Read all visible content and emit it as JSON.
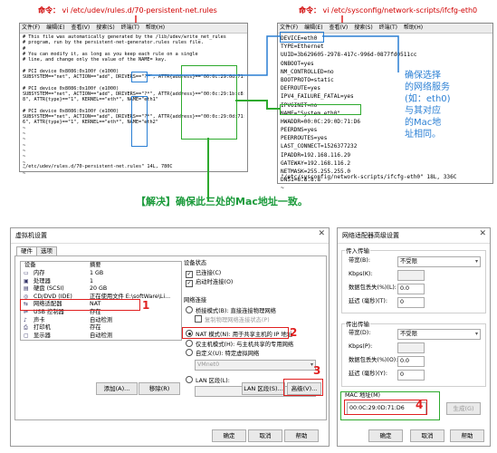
{
  "annotations": {
    "left_cmd_prefix": "命令：",
    "left_cmd_path": "vi /etc/udev/rules.d/70-persistent-net.rules",
    "right_cmd_prefix": "命令：",
    "right_cmd_path": "vi /etc/sysconfig/network-scripts/ifcfg-eth0",
    "blue_note": [
      "确保选择",
      "的网络服务",
      "(如：eth0)",
      "与其对应",
      "的Mac地",
      "址相同。"
    ],
    "solution": "【解决】确保此三处的Mac地址一致。",
    "markers": [
      "1",
      "2",
      "3",
      "4"
    ],
    "colors": {
      "red": "#e02020",
      "green": "#2eaa2e",
      "blue": "#2a7fd4"
    }
  },
  "term_menu": [
    "文件(F)",
    "编辑(E)",
    "查看(V)",
    "搜索(S)",
    "终端(T)",
    "帮助(H)"
  ],
  "left_terminal": {
    "lines": [
      "# This file was automatically generated by the /lib/udev/write_net_rules",
      "# program, run by the persistent-net-generator.rules rules file.",
      "#",
      "# You can modify it, as long as you keep each rule on a single",
      "# line, and change only the value of the NAME= key.",
      "",
      "# PCI device 0x8086:0x100f (e1000)",
      "SUBSYSTEM==\"net\", ACTION==\"add\", DRIVERS==\"?*\", ATTR{address}==\"00:0c:29:0d:71:d6\", ATTR{type}==\"1\", KERNEL==\"eth*\", NAME=\"eth0\"",
      "",
      "# PCI device 0x8086:0x100f (e1000)",
      "SUBSYSTEM==\"net\", ACTION==\"add\", DRIVERS==\"?*\", ATTR{address}==\"00:0c:29:1b:c8:0\"",
      "8\", ATTR{type}==\"1\", KERNEL==\"eth*\", NAME=\"eth1\"",
      "",
      "# PCI device 0x8086:0x100f (e1000)",
      "SUBSYSTEM==\"net\", ACTION==\"add\", DRIVERS==\"?*\", ATTR{address}==\"00:0c:29:0d:71:d",
      "6\", ATTR{type}==\"1\", KERNEL==\"eth*\", NAME=\"eth2\"",
      "~",
      "~",
      "~",
      "~",
      "~",
      "~",
      "~",
      "~",
      "~"
    ],
    "status": "\"/etc/udev/rules.d/70-persistent-net.rules\" 14L, 780C"
  },
  "right_terminal": {
    "lines": [
      "DEVICE=eth0",
      "TYPE=Ethernet",
      "UUID=3b629605-2978-417c-996d-0877fd0511cc",
      "ONBOOT=yes",
      "NM_CONTROLLED=no",
      "BOOTPROTO=static",
      "DEFROUTE=yes",
      "IPV4_FAILURE_FATAL=yes",
      "IPV6INIT=no",
      "NAME=\"System eth0\"",
      "HWADDR=00:0C:29:0D:71:D6",
      "PEERDNS=yes",
      "PEERROUTES=yes",
      "LAST_CONNECT=1526377232",
      "IPADDR=192.168.116.29",
      "GATEWAY=192.168.116.2",
      "NETMASK=255.255.255.0",
      "DNS1=8.8.8.8",
      "~"
    ],
    "status": "\"/etc/sysconfig/network-scripts/ifcfg-eth0\" 18L, 336C"
  },
  "vm_dialog": {
    "title": "虚拟机设置",
    "tabs": [
      "硬件",
      "选项"
    ],
    "col_device": "设备",
    "col_summary": "摘要",
    "devices": [
      {
        "icon": "▭",
        "name": "内存",
        "summary": "1 GB"
      },
      {
        "icon": "▣",
        "name": "处理器",
        "summary": "1"
      },
      {
        "icon": "▤",
        "name": "硬盘 (SCSI)",
        "summary": "20 GB"
      },
      {
        "icon": "◎",
        "name": "CD/DVD (IDE)",
        "summary": "正在使用文件 E:\\softWare\\Li..."
      },
      {
        "icon": "⇆",
        "name": "网络适配器",
        "summary": "NAT"
      },
      {
        "icon": "⇌",
        "name": "USB 控制器",
        "summary": "存在"
      },
      {
        "icon": "♪",
        "name": "声卡",
        "summary": "自动检测"
      },
      {
        "icon": "⎙",
        "name": "打印机",
        "summary": "存在"
      },
      {
        "icon": "▢",
        "name": "显示器",
        "summary": "自动检测"
      }
    ],
    "device_status": "设备状态",
    "connected": "已连接(C)",
    "connect_on_power": "启动时连接(O)",
    "network_conn": "网络连接",
    "bridged": "桥接模式(B): 直接连接物理网络",
    "replicate": "复制物理网络连接状态(P)",
    "nat": "NAT 模式(N): 用于共享主机的 IP 地址",
    "host_only": "仅主机模式(H): 与主机共享的专用网络",
    "custom": "自定义(U): 特定虚拟网络",
    "vmnet": "VMnet0",
    "lan": "LAN 区段(L):",
    "add": "添加(A)...",
    "remove": "移除(R)",
    "lan_segments": "LAN 区段(S)...",
    "advanced": "高级(V)...",
    "ok": "确定",
    "cancel": "取消",
    "help": "帮助"
  },
  "adv_dialog": {
    "title": "网络适配器高级设置",
    "incoming": "传入传输",
    "outgoing": "传出传输",
    "bandwidth": "带宽(B):",
    "bandwidth_out": "带宽(D):",
    "bandwidth_val": "不受限",
    "kbps": "Kbps(K):",
    "kbps_out": "Kbps(P):",
    "loss": "数据包丢失(%)(L):",
    "loss_out": "数据包丢失(%)(O):",
    "latency": "延迟 (毫秒)(T):",
    "latency_out": "延迟 (毫秒)(Y):",
    "zero": "0",
    "zero_f": "0.0",
    "mac_label": "MAC 地址(M)",
    "mac_value": "00:0C:29:0D:71:D6",
    "generate": "生成(G)",
    "ok": "确定",
    "cancel": "取消",
    "help": "帮助"
  }
}
